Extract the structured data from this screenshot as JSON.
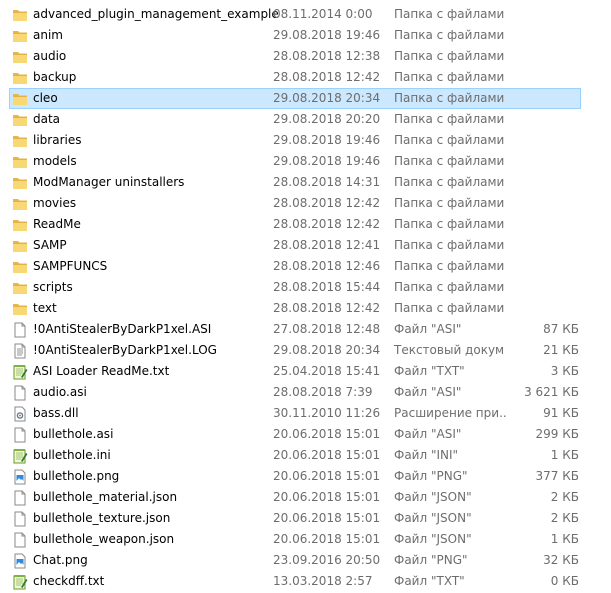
{
  "rows": [
    {
      "name": "advanced_plugin_management_example",
      "date": "08.11.2014 0:00",
      "type": "Папка с файлами",
      "size": "",
      "icon": "folder-icon"
    },
    {
      "name": "anim",
      "date": "29.08.2018 19:46",
      "type": "Папка с файлами",
      "size": "",
      "icon": "folder-icon"
    },
    {
      "name": "audio",
      "date": "28.08.2018 12:38",
      "type": "Папка с файлами",
      "size": "",
      "icon": "folder-icon"
    },
    {
      "name": "backup",
      "date": "28.08.2018 12:42",
      "type": "Папка с файлами",
      "size": "",
      "icon": "folder-icon"
    },
    {
      "name": "cleo",
      "date": "29.08.2018 20:34",
      "type": "Папка с файлами",
      "size": "",
      "icon": "folder-icon",
      "selected": true
    },
    {
      "name": "data",
      "date": "29.08.2018 20:20",
      "type": "Папка с файлами",
      "size": "",
      "icon": "folder-icon"
    },
    {
      "name": "libraries",
      "date": "29.08.2018 19:46",
      "type": "Папка с файлами",
      "size": "",
      "icon": "folder-icon"
    },
    {
      "name": "models",
      "date": "29.08.2018 19:46",
      "type": "Папка с файлами",
      "size": "",
      "icon": "folder-icon"
    },
    {
      "name": "ModManager uninstallers",
      "date": "28.08.2018 14:31",
      "type": "Папка с файлами",
      "size": "",
      "icon": "folder-icon"
    },
    {
      "name": "movies",
      "date": "28.08.2018 12:42",
      "type": "Папка с файлами",
      "size": "",
      "icon": "folder-icon"
    },
    {
      "name": "ReadMe",
      "date": "28.08.2018 12:42",
      "type": "Папка с файлами",
      "size": "",
      "icon": "folder-icon"
    },
    {
      "name": "SAMP",
      "date": "28.08.2018 12:41",
      "type": "Папка с файлами",
      "size": "",
      "icon": "folder-icon"
    },
    {
      "name": "SAMPFUNCS",
      "date": "28.08.2018 12:46",
      "type": "Папка с файлами",
      "size": "",
      "icon": "folder-icon"
    },
    {
      "name": "scripts",
      "date": "28.08.2018 15:44",
      "type": "Папка с файлами",
      "size": "",
      "icon": "folder-icon"
    },
    {
      "name": "text",
      "date": "28.08.2018 12:42",
      "type": "Папка с файлами",
      "size": "",
      "icon": "folder-icon"
    },
    {
      "name": "!0AntiStealerByDarkP1xel.ASI",
      "date": "27.08.2018 12:48",
      "type": "Файл \"ASI\"",
      "size": "87 КБ",
      "icon": "file-icon"
    },
    {
      "name": "!0AntiStealerByDarkP1xel.LOG",
      "date": "29.08.2018 20:34",
      "type": "Текстовый докум",
      "size": "21 КБ",
      "icon": "text-document-icon"
    },
    {
      "name": "ASI Loader ReadMe.txt",
      "date": "25.04.2018 15:41",
      "type": "Файл \"TXT\"",
      "size": "3 КБ",
      "icon": "notepad-plus-icon"
    },
    {
      "name": "audio.asi",
      "date": "28.08.2018 7:39",
      "type": "Файл \"ASI\"",
      "size": "3 621 КБ",
      "icon": "file-icon"
    },
    {
      "name": "bass.dll",
      "date": "30.11.2010 11:26",
      "type": "Расширение при...",
      "size": "91 КБ",
      "icon": "dll-gear-icon"
    },
    {
      "name": "bullethole.asi",
      "date": "20.06.2018 15:01",
      "type": "Файл \"ASI\"",
      "size": "299 КБ",
      "icon": "file-icon"
    },
    {
      "name": "bullethole.ini",
      "date": "20.06.2018 15:01",
      "type": "Файл \"INI\"",
      "size": "1 КБ",
      "icon": "notepad-plus-icon"
    },
    {
      "name": "bullethole.png",
      "date": "20.06.2018 15:01",
      "type": "Файл \"PNG\"",
      "size": "377 КБ",
      "icon": "image-file-icon"
    },
    {
      "name": "bullethole_material.json",
      "date": "20.06.2018 15:01",
      "type": "Файл \"JSON\"",
      "size": "2 КБ",
      "icon": "file-icon"
    },
    {
      "name": "bullethole_texture.json",
      "date": "20.06.2018 15:01",
      "type": "Файл \"JSON\"",
      "size": "2 КБ",
      "icon": "file-icon"
    },
    {
      "name": "bullethole_weapon.json",
      "date": "20.06.2018 15:01",
      "type": "Файл \"JSON\"",
      "size": "1 КБ",
      "icon": "file-icon"
    },
    {
      "name": "Chat.png",
      "date": "23.09.2016 20:50",
      "type": "Файл \"PNG\"",
      "size": "32 КБ",
      "icon": "image-file-icon"
    },
    {
      "name": "checkdff.txt",
      "date": "13.03.2018 2:57",
      "type": "Файл \"TXT\"",
      "size": "0 КБ",
      "icon": "notepad-plus-icon"
    }
  ],
  "colors": {
    "folder": "#f2c55c",
    "selection_bg": "#cce8ff",
    "selection_border": "#99d1ff",
    "meta_text": "#6d6d6d"
  }
}
